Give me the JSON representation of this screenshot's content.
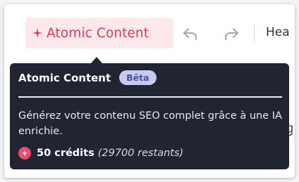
{
  "toolbar": {
    "atomic_button_label": "Atomic Content",
    "heading_select_value": "Hea",
    "undo_icon": "undo-icon",
    "redo_icon": "redo-icon"
  },
  "tooltip": {
    "title": "Atomic Content",
    "badge": "Bêta",
    "description": "Générez votre contenu SEO complet grâce à une IA enrichie.",
    "credits_amount": "50 crédits",
    "credits_remaining": "(29700 restants)"
  },
  "background_text": "g",
  "colors": {
    "accent": "#e6394f",
    "accent_bg": "#fde8ec",
    "tooltip_bg": "#212431",
    "badge_bg": "#c7c9ef",
    "badge_text": "#4c4fa7",
    "credit_icon": "#f0486a"
  }
}
